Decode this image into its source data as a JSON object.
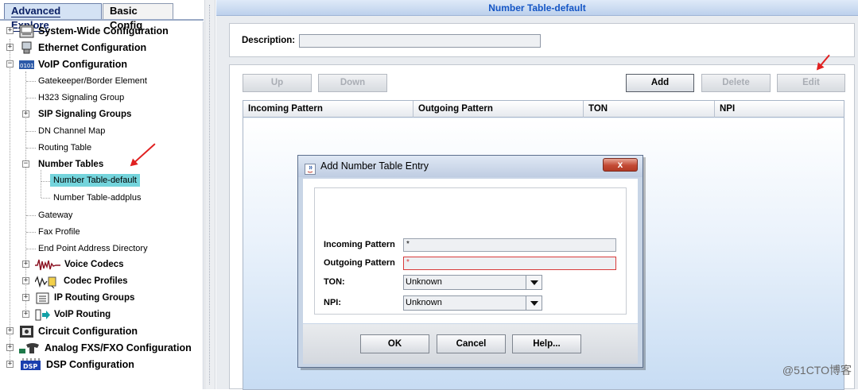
{
  "left_panel": {
    "tabs": [
      {
        "label": "Advanced Explore",
        "active": true
      },
      {
        "label": "Basic Config",
        "active": false
      }
    ],
    "tree": {
      "system_wide": "System-Wide Configuration",
      "ethernet": "Ethernet Configuration",
      "voip": "VoIP Configuration",
      "gatekeeper": "Gatekeeper/Border Element",
      "h323": "H323 Signaling Group",
      "sip": "SIP Signaling Groups",
      "dn_channel": "DN Channel Map",
      "routing_table": "Routing Table",
      "number_tables": "Number Tables",
      "number_table_default": "Number Table-default",
      "number_table_addplus": "Number Table-addplus",
      "gateway": "Gateway",
      "fax_profile": "Fax Profile",
      "endpoint_dir": "End Point Address Directory",
      "voice_codecs": "Voice Codecs",
      "codec_profiles": "Codec Profiles",
      "ip_routing": "IP Routing Groups",
      "voip_routing": "VoIP Routing",
      "circuit": "Circuit Configuration",
      "analog": "Analog FXS/FXO Configuration",
      "dsp": "DSP Configuration",
      "dsp_icon_text": "DSP"
    }
  },
  "right_panel": {
    "title": "Number Table-default",
    "description_label": "Description:",
    "description_value": "",
    "buttons": {
      "up": "Up",
      "down": "Down",
      "add": "Add",
      "delete": "Delete",
      "edit": "Edit"
    },
    "columns": [
      "Incoming Pattern",
      "Outgoing Pattern",
      "TON",
      "NPI"
    ]
  },
  "dialog": {
    "title": "Add Number Table Entry",
    "close_label": "x",
    "incoming_label": "Incoming Pattern",
    "incoming_value": "*",
    "outgoing_label": "Outgoing Pattern",
    "outgoing_value": "*",
    "ton_label": "TON:",
    "ton_value": "Unknown",
    "npi_label": "NPI:",
    "npi_value": "Unknown",
    "ok": "OK",
    "cancel": "Cancel",
    "help": "Help..."
  },
  "watermark": "@51CTO博客",
  "colors": {
    "title_blue": "#1455c5",
    "selected_bg": "#74d4dc",
    "required_border": "#d83a3a",
    "annotation_red": "#e02020"
  }
}
